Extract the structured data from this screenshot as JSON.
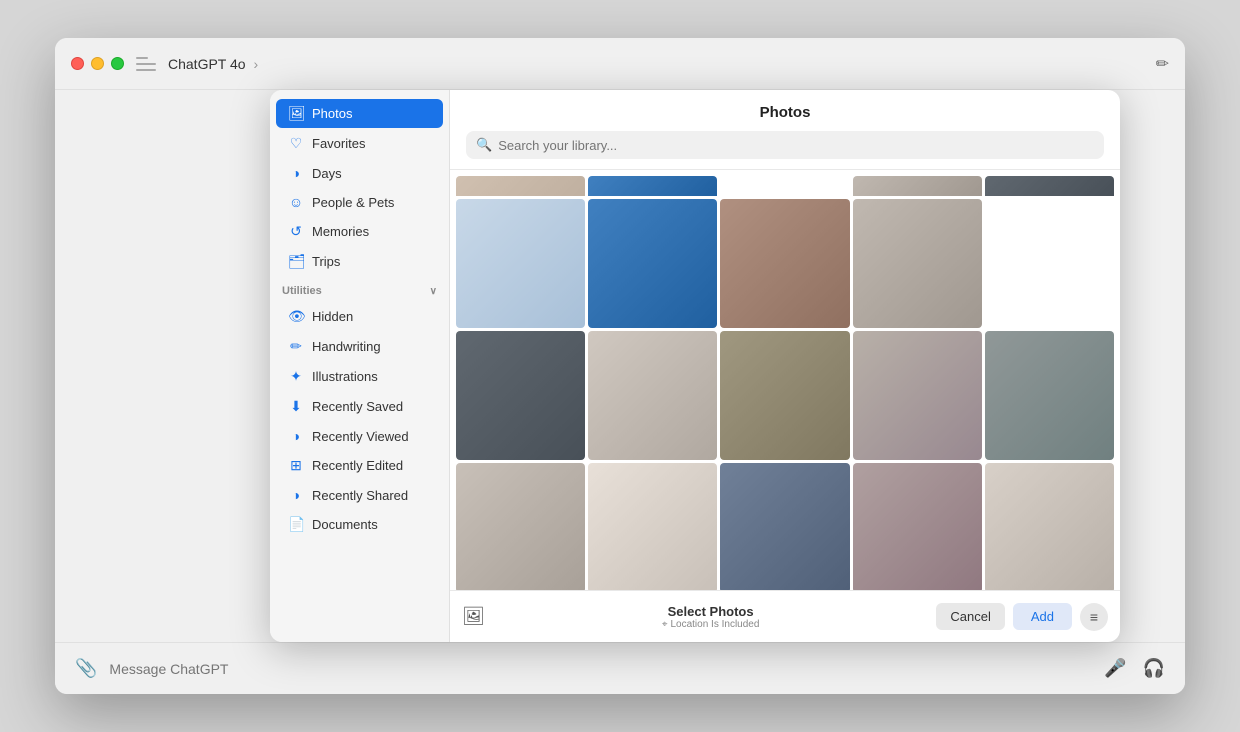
{
  "window": {
    "title": "ChatGPT 4o",
    "chevron": "›"
  },
  "titleBar": {
    "appName": "ChatGPT",
    "modelName": "4o",
    "chevron": "›"
  },
  "messageBar": {
    "placeholder": "Message ChatGPT"
  },
  "dialog": {
    "title": "Photos",
    "search": {
      "placeholder": "Search your library..."
    },
    "sidebar": {
      "items": [
        {
          "id": "photos",
          "label": "Photos",
          "icon": "🖼",
          "active": true
        },
        {
          "id": "favorites",
          "label": "Favorites",
          "icon": "♡"
        },
        {
          "id": "days",
          "label": "Days",
          "icon": "⊙"
        },
        {
          "id": "people-pets",
          "label": "People & Pets",
          "icon": "☺"
        },
        {
          "id": "memories",
          "label": "Memories",
          "icon": "↺"
        },
        {
          "id": "trips",
          "label": "Trips",
          "icon": "🗂"
        }
      ],
      "utilitiesHeader": "Utilities",
      "utilityItems": [
        {
          "id": "hidden",
          "label": "Hidden",
          "icon": "👁"
        },
        {
          "id": "handwriting",
          "label": "Handwriting",
          "icon": "✏"
        },
        {
          "id": "illustrations",
          "label": "Illustrations",
          "icon": "✦"
        },
        {
          "id": "recently-saved",
          "label": "Recently Saved",
          "icon": "⬇"
        },
        {
          "id": "recently-viewed",
          "label": "Recently Viewed",
          "icon": "⊙"
        },
        {
          "id": "recently-edited",
          "label": "Recently Edited",
          "icon": "⊞"
        },
        {
          "id": "recently-shared",
          "label": "Recently Shared",
          "icon": "⊙"
        },
        {
          "id": "documents",
          "label": "Documents",
          "icon": "📄"
        }
      ]
    },
    "footer": {
      "selectLabel": "Select Photos",
      "locationLabel": "Location Is Included",
      "cancelLabel": "Cancel",
      "addLabel": "Add"
    }
  }
}
